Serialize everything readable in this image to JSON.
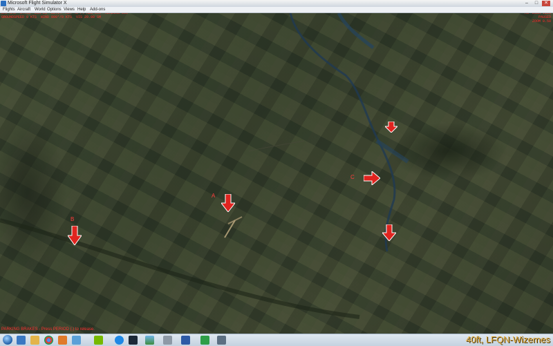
{
  "window": {
    "title": "Microsoft Flight Simulator X",
    "controls": [
      "–",
      "□",
      "✕"
    ]
  },
  "menu": {
    "items": [
      "Flights",
      "Aircraft",
      "World",
      "Options",
      "Views",
      "Help",
      "Add-ons"
    ]
  },
  "hud": {
    "left": "LAT N49° 34.93' LON E3° 22.14' ALT 40 FT HDG 000° HEADING 000°\nGROUNDSPEED 0 KTS  WIND 000°/0 KTS  VIS 20.00 SM",
    "right": "TOP DOWN VIEW\nPAUSED\nZOOM 0.50"
  },
  "markers": {
    "a_label": "A",
    "b_label": "B",
    "c_label": "C"
  },
  "status": {
    "message": "PARKING BRAKES - Press PERIOD (.) to release.",
    "location": "40ft, LFQN-Wizernes"
  },
  "colors": {
    "marker_fill": "#e0241f",
    "hud_text": "#ff2a2a",
    "location_text": "#e8b040"
  },
  "taskbar": {
    "icons": [
      "start-icon",
      "ie-icon",
      "folder-icon",
      "chrome-icon",
      "media-icon",
      "paint-icon",
      "nvidia-icon",
      "edge-icon",
      "steam-icon",
      "landscape-icon",
      "email-icon",
      "fsx-icon",
      "bird-icon",
      "monitor-icon"
    ]
  }
}
